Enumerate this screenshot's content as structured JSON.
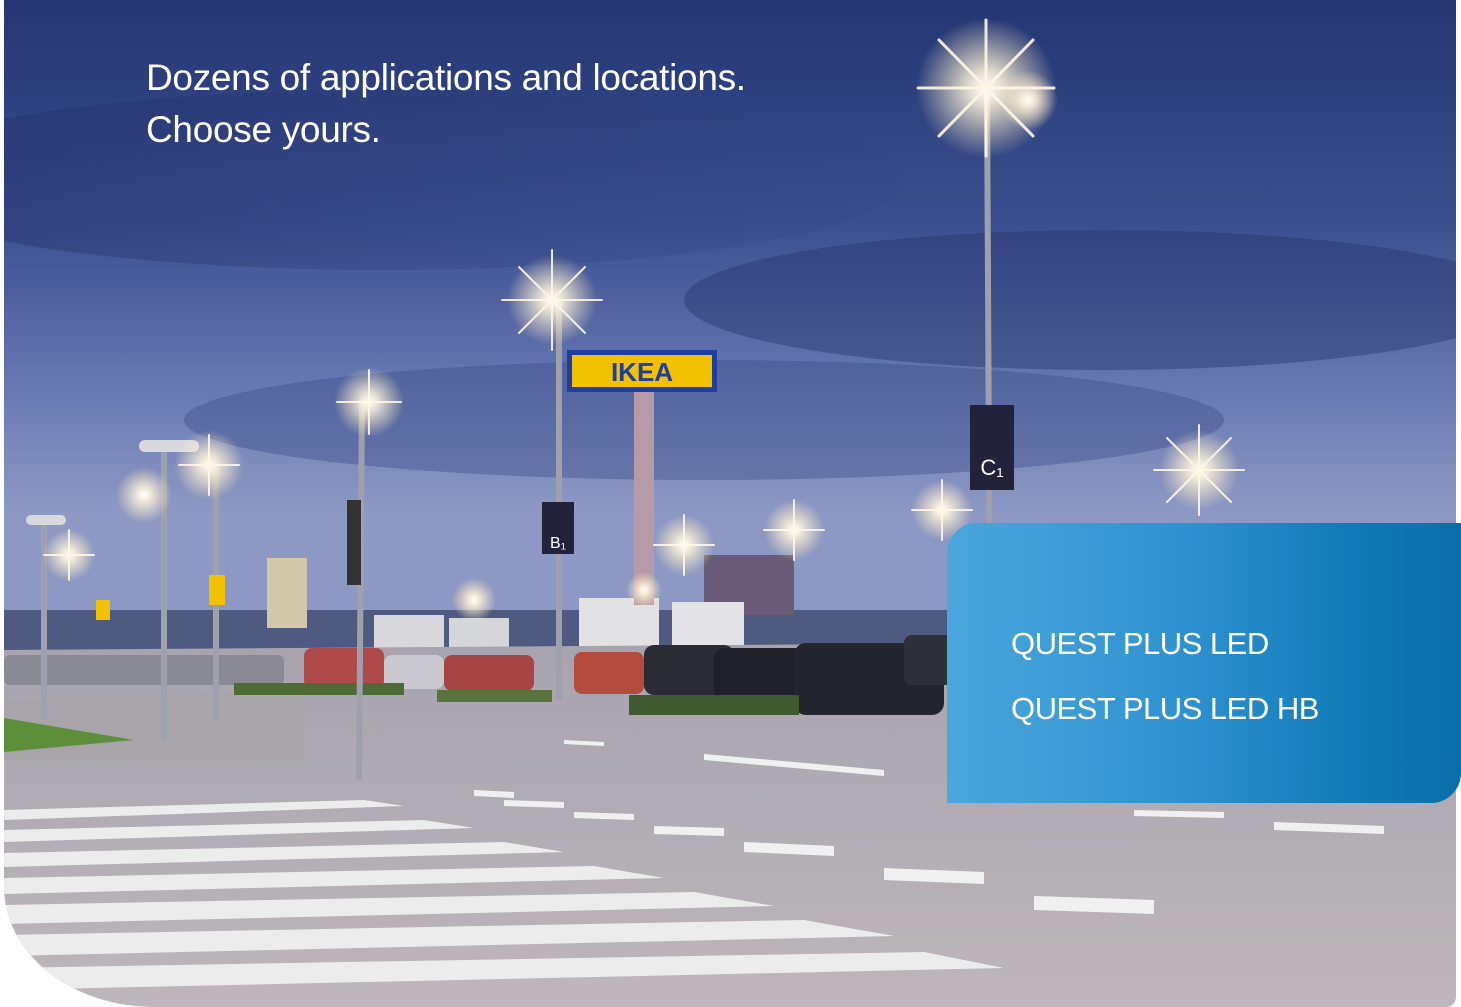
{
  "headline": {
    "line1": "Dozens of applications and locations.",
    "line2": "Choose yours."
  },
  "scene": {
    "store_sign": "IKEA",
    "zone_sign_b": "B₁",
    "zone_sign_c": "C₁"
  },
  "products": [
    {
      "name": "QUEST PLUS LED"
    },
    {
      "name": "QUEST PLUS LED HB"
    }
  ],
  "colors": {
    "panel_light": "#4aa6dc",
    "panel_dark": "#0a6fa8",
    "sky_top": "#2a3c78",
    "sign_yellow": "#f2c200",
    "sign_blue": "#1e3fa0"
  }
}
